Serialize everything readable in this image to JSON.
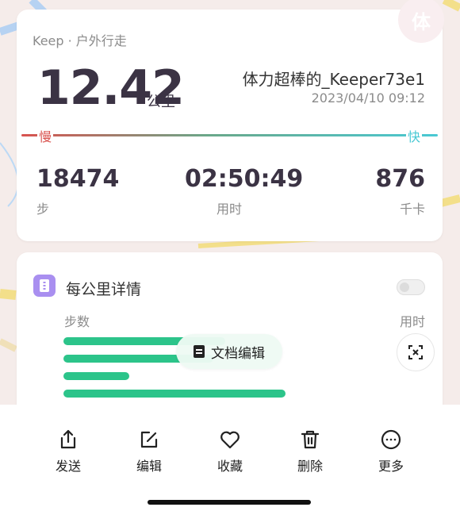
{
  "header": {
    "source": "Keep · 户外行走",
    "badge_char": "体",
    "distance": "12.42",
    "distance_unit": "公里",
    "username": "体力超棒的_Keeper73e1",
    "datetime": "2023/04/10 09:12"
  },
  "pace": {
    "slow_label": "慢",
    "fast_label": "快"
  },
  "stats": [
    {
      "value": "18474",
      "label": "步"
    },
    {
      "value": "02:50:49",
      "label": "用时"
    },
    {
      "value": "876",
      "label": "千卡"
    }
  ],
  "detail": {
    "title": "每公里详情",
    "col_steps": "步数",
    "col_time": "用时",
    "doc_edit_label": "文档编辑",
    "bars": [
      0.54,
      0.5,
      0.22,
      0.74
    ]
  },
  "bottom_actions": [
    {
      "label": "发送",
      "icon": "share-icon"
    },
    {
      "label": "编辑",
      "icon": "edit-icon"
    },
    {
      "label": "收藏",
      "icon": "heart-icon"
    },
    {
      "label": "删除",
      "icon": "trash-icon"
    },
    {
      "label": "更多",
      "icon": "more-icon"
    }
  ],
  "colors": {
    "accent_green": "#2cc48a",
    "pace_slow": "#d9534f",
    "pace_fast": "#49c9d4",
    "icon_purple": "#a98ff0"
  }
}
